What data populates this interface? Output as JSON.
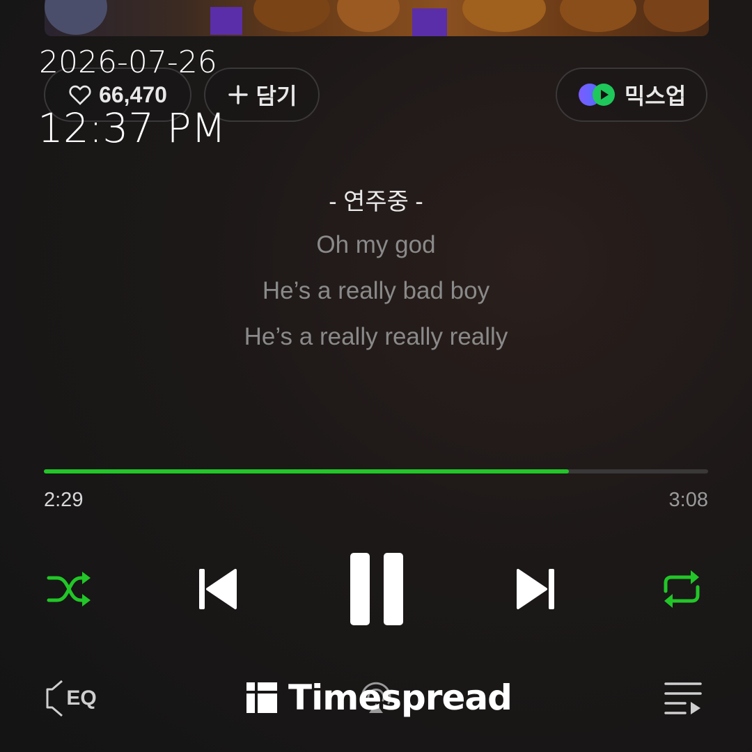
{
  "overlay": {
    "date": "2026-07-26",
    "time": "12:37 PM"
  },
  "actions": {
    "like_count": "66,470",
    "add_label": "담기",
    "mixup_label": "믹스업"
  },
  "lyrics": {
    "status": "- 연주중 -",
    "lines": [
      "Oh my god",
      "He’s a really bad boy",
      "He’s a really really really"
    ]
  },
  "playback": {
    "elapsed": "2:29",
    "total": "3:08",
    "progress_fraction": 0.79
  },
  "bottom": {
    "brand": "Timespread",
    "eq_label": "EQ"
  },
  "colors": {
    "accent": "#22c628",
    "background": "#161616"
  }
}
